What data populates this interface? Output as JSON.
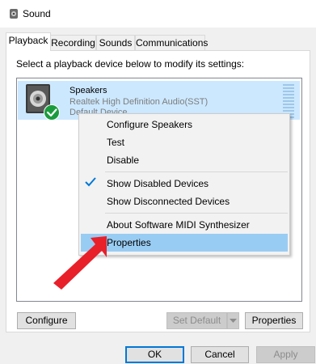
{
  "window": {
    "title": "Sound"
  },
  "tabs": [
    {
      "label": "Playback"
    },
    {
      "label": "Recording"
    },
    {
      "label": "Sounds"
    },
    {
      "label": "Communications"
    }
  ],
  "playback": {
    "instructions": "Select a playback device below to modify its settings:",
    "device": {
      "name": "Speakers",
      "driver": "Realtek High Definition Audio(SST)",
      "status": "Default Device",
      "status_icon": "green-check-icon"
    }
  },
  "context_menu": {
    "items": [
      {
        "label": "Configure Speakers"
      },
      {
        "label": "Test"
      },
      {
        "label": "Disable"
      },
      {
        "label": "Show Disabled Devices",
        "checked": true
      },
      {
        "label": "Show Disconnected Devices"
      },
      {
        "label": "About Software MIDI Synthesizer"
      },
      {
        "label": "Properties",
        "highlighted": true
      }
    ]
  },
  "panel_buttons": {
    "configure": "Configure",
    "set_default": "Set Default",
    "properties": "Properties"
  },
  "dialog_buttons": {
    "ok": "OK",
    "cancel": "Cancel",
    "apply": "Apply"
  },
  "colors": {
    "selection": "#cce8ff",
    "menu_highlight": "#99ccf3",
    "accent": "#0078d7",
    "annotation_arrow": "#e8202a",
    "check_green": "#1a9c3e"
  }
}
